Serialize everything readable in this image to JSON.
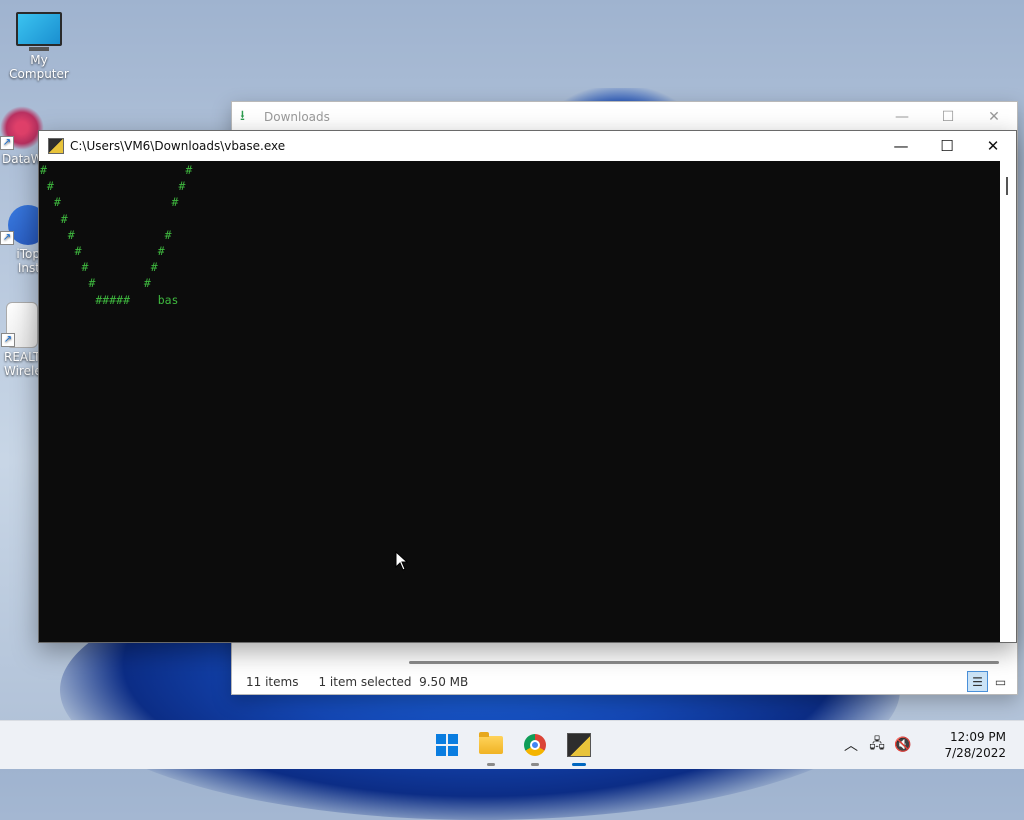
{
  "desktop": {
    "icons": [
      {
        "label": "My Computer"
      },
      {
        "label": "DataW"
      },
      {
        "label": "iTop\nInst"
      },
      {
        "label": "REALTI\nWirele"
      }
    ]
  },
  "explorer": {
    "title": "Downloads",
    "status_items": "11 items",
    "status_selected": "1 item selected  9.50 MB"
  },
  "console": {
    "title": "C:\\Users\\VM6\\Downloads\\vbase.exe",
    "output": "#                    #\n #                  #\n  #                #\n   #\n    #             #\n     #           #\n      #         #\n       #       #\n        #####    bas"
  },
  "taskbar": {
    "apps": [
      "start-icon",
      "file-explorer-icon",
      "chrome-icon",
      "vbase-console-icon"
    ],
    "time": "12:09 PM",
    "date": "7/28/2022"
  },
  "colors": {
    "console_bg": "#0c0c0c",
    "console_text": "#3fb93f",
    "accent": "#0067c0"
  }
}
